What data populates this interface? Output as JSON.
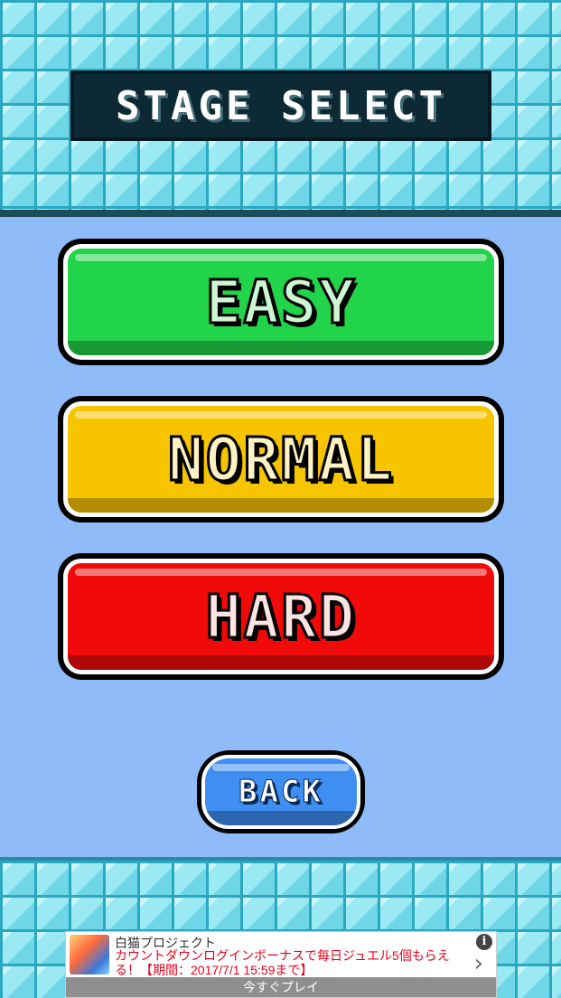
{
  "title": "STAGE SELECT",
  "buttons": {
    "easy": "EASY",
    "normal": "NORMAL",
    "hard": "HARD",
    "back": "BACK"
  },
  "colors": {
    "sky": "#8fbcf8",
    "easy": "#22d44a",
    "normal": "#f7c400",
    "hard": "#f00a0a",
    "back": "#3f8ef2"
  },
  "ad": {
    "title": "白猫プロジェクト",
    "body": "カウントダウンログインボーナスで毎日ジュエル5個もらえる！【期間：2017/7/1 15:59まで】",
    "cta": "今すぐプレイ",
    "info_icon": "i"
  }
}
